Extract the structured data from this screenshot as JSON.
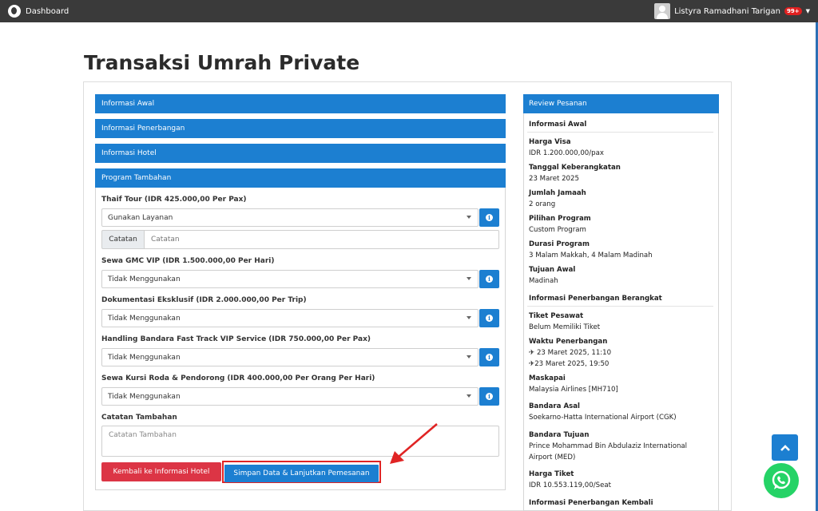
{
  "topbar": {
    "brand": "Dashboard",
    "user_name": "Listyra Ramadhani Tarigan",
    "notif_badge": "99+"
  },
  "page": {
    "title": "Transaksi Umrah Private"
  },
  "accordion": {
    "informasi_awal": "Informasi Awal",
    "informasi_penerbangan": "Informasi Penerbangan",
    "informasi_hotel": "Informasi Hotel",
    "program_tambahan": "Program Tambahan"
  },
  "form": {
    "thaif": {
      "label": "Thaif Tour (IDR 425.000,00 Per Pax)",
      "value": "Gunakan Layanan"
    },
    "catatan": {
      "addon": "Catatan",
      "placeholder": "Catatan"
    },
    "gmc": {
      "label": "Sewa GMC VIP (IDR 1.500.000,00 Per Hari)",
      "value": "Tidak Menggunakan"
    },
    "dokumentasi": {
      "label": "Dokumentasi Eksklusif (IDR 2.000.000,00 Per Trip)",
      "value": "Tidak Menggunakan"
    },
    "handling": {
      "label": "Handling Bandara Fast Track VIP Service (IDR 750.000,00 Per Pax)",
      "value": "Tidak Menggunakan"
    },
    "kursi": {
      "label": "Sewa Kursi Roda & Pendorong (IDR 400.000,00 Per Orang Per Hari)",
      "value": "Tidak Menggunakan"
    },
    "catatan_tambahan": {
      "label": "Catatan Tambahan",
      "placeholder": "Catatan Tambahan"
    },
    "btn_back": "Kembali ke Informasi Hotel",
    "btn_save": "Simpan Data & Lanjutkan Pemesanan"
  },
  "review": {
    "header": "Review Pesanan",
    "sec1": "Informasi Awal",
    "harga_visa_l": "Harga Visa",
    "harga_visa_v": "IDR 1.200.000,00/pax",
    "tgl_l": "Tanggal Keberangkatan",
    "tgl_v": "23 Maret 2025",
    "jamaah_l": "Jumlah Jamaah",
    "jamaah_v": "2 orang",
    "program_l": "Pilihan Program",
    "program_v": "Custom Program",
    "durasi_l": "Durasi Program",
    "durasi_v": "3 Malam Makkah, 4 Malam Madinah",
    "tujuan_l": "Tujuan Awal",
    "tujuan_v": "Madinah",
    "sec2": "Informasi Penerbangan Berangkat",
    "tiket_l": "Tiket Pesawat",
    "tiket_v": "Belum Memiliki Tiket",
    "waktu_l": "Waktu Penerbangan",
    "waktu_dep": "23 Maret 2025, 11:10",
    "waktu_arr": "23 Maret 2025, 19:50",
    "maskapai_l": "Maskapai",
    "maskapai_v": "Malaysia Airlines [MH710]",
    "asal_l": "Bandara Asal",
    "asal_v": "Soekarno-Hatta International Airport (CGK)",
    "tujuan_bandara_l": "Bandara Tujuan",
    "tujuan_bandara_v1": "Prince Mohammad Bin Abdulaziz International",
    "tujuan_bandara_v2": "Airport (MED)",
    "harga_tiket_l": "Harga Tiket",
    "harga_tiket_v": "IDR 10.553.119,00/Seat",
    "sec3": "Informasi Penerbangan Kembali"
  }
}
